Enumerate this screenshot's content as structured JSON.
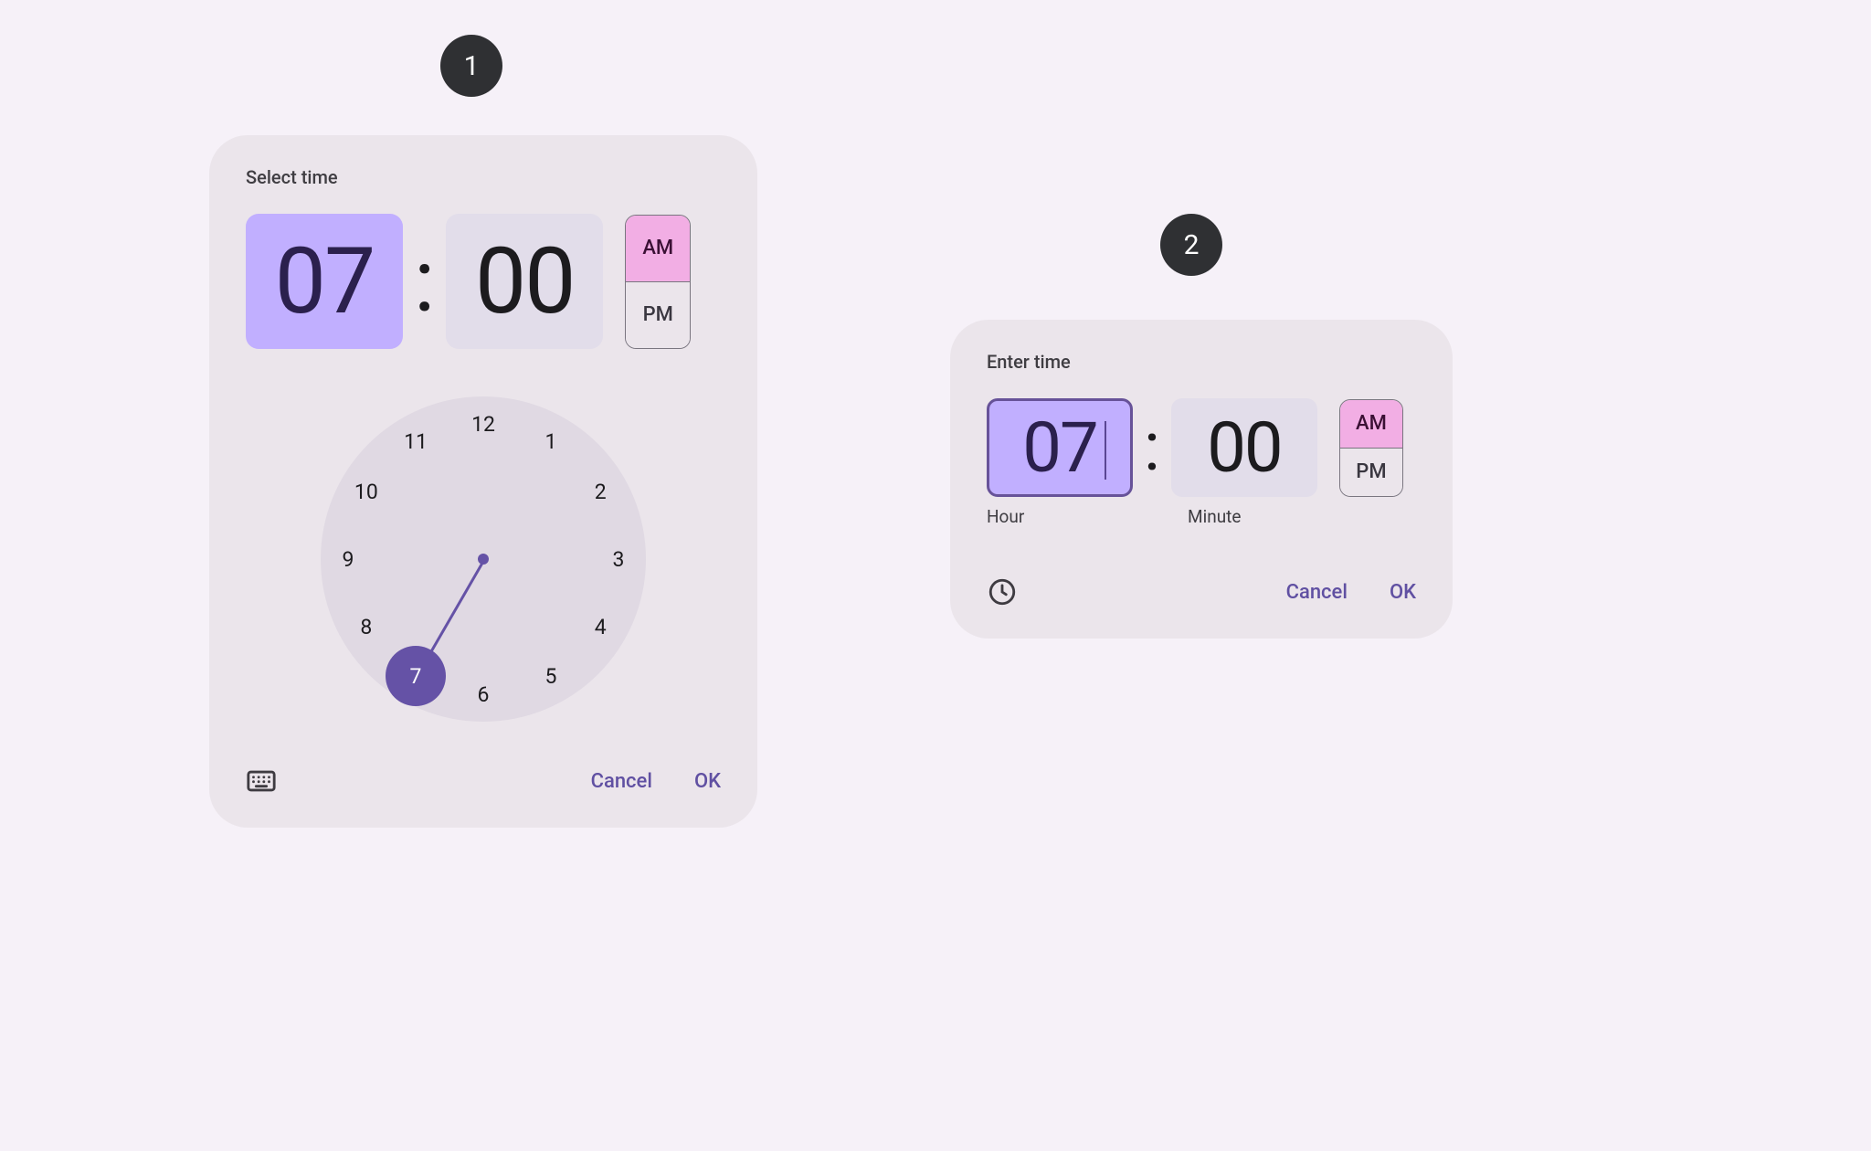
{
  "dial_picker": {
    "title": "Select time",
    "hour": "07",
    "minute": "00",
    "colon": ":",
    "am_label": "AM",
    "pm_label": "PM",
    "period_selected": "AM",
    "selected_hour_on_clock": 7,
    "clock_numbers": [
      "12",
      "1",
      "2",
      "3",
      "4",
      "5",
      "6",
      "7",
      "8",
      "9",
      "10",
      "11"
    ],
    "mode_icon": "keyboard-icon",
    "cancel": "Cancel",
    "ok": "OK"
  },
  "input_picker": {
    "title": "Enter time",
    "hour": "07",
    "minute": "00",
    "colon": ":",
    "hour_helper": "Hour",
    "minute_helper": "Minute",
    "am_label": "AM",
    "pm_label": "PM",
    "period_selected": "AM",
    "mode_icon": "clock-icon",
    "cancel": "Cancel",
    "ok": "OK"
  },
  "callouts": {
    "one": "1",
    "two": "2"
  },
  "clock_geometry": {
    "radius_px": 178,
    "number_radius_px": 148,
    "selected_index": 7,
    "hand_angle_deg": 30
  }
}
